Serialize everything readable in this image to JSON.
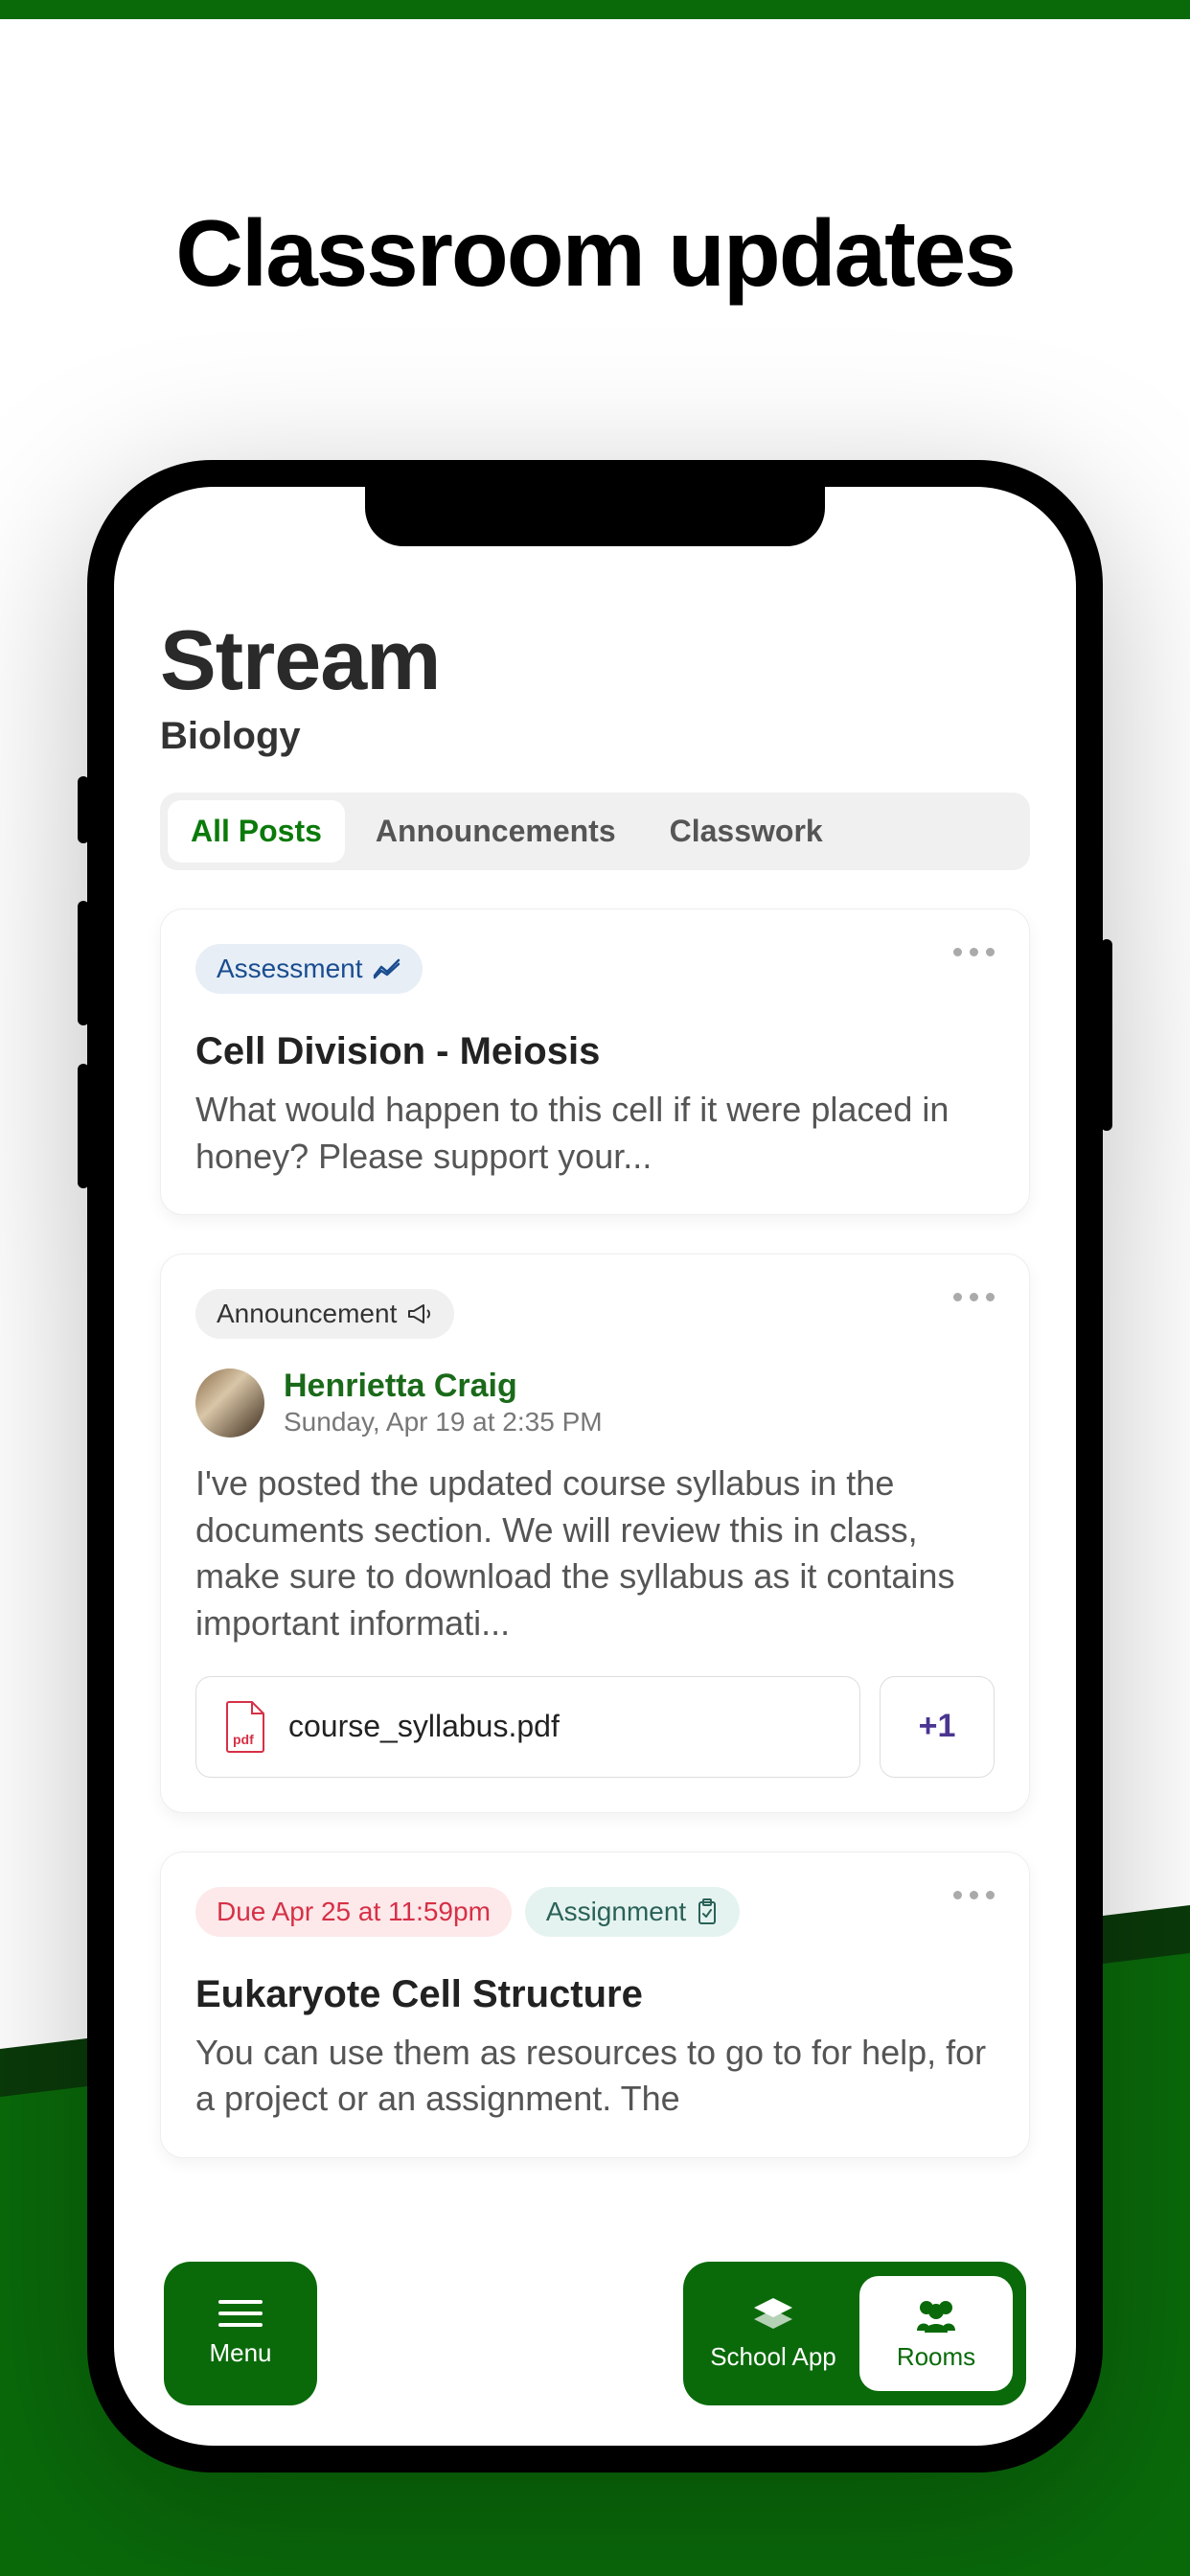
{
  "headline": "Classroom updates",
  "stream": {
    "title": "Stream",
    "subject": "Biology"
  },
  "tabs": [
    {
      "label": "All Posts",
      "active": true
    },
    {
      "label": "Announcements",
      "active": false
    },
    {
      "label": "Classwork",
      "active": false
    }
  ],
  "cards": {
    "assessment": {
      "pill_label": "Assessment",
      "title": "Cell Division - Meiosis",
      "body": "What would happen to this cell if it were placed in honey? Please support your..."
    },
    "announcement": {
      "pill_label": "Announcement",
      "author_name": "Henrietta Craig",
      "author_date": "Sunday, Apr 19 at 2:35 PM",
      "body": "I've posted the updated course syllabus in the documents section. We will review this in class, make sure to download the syllabus as it contains important informati...",
      "attachment_name": "course_syllabus.pdf",
      "attachment_more": "+1"
    },
    "assignment": {
      "due_label": "Due Apr 25 at 11:59pm",
      "pill_label": "Assignment",
      "title": "Eukaryote Cell Structure",
      "body": "You can use them as resources to go to for help, for a project or an assignment. The"
    }
  },
  "nav": {
    "menu": "Menu",
    "school_app": "School App",
    "rooms": "Rooms"
  }
}
